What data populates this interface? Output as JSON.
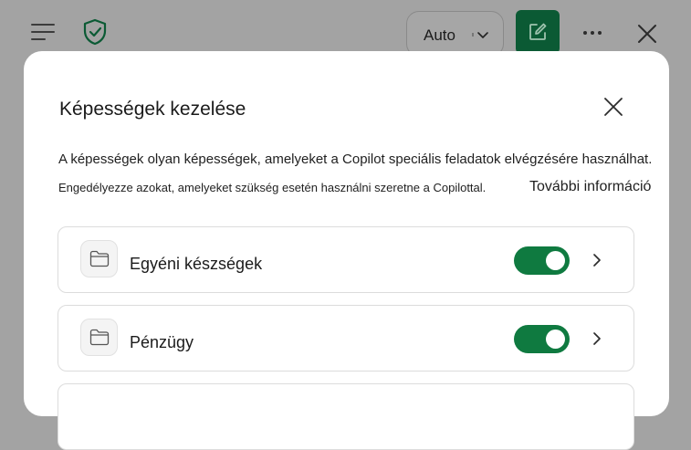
{
  "topbar": {
    "model_select": {
      "value": "Auto"
    }
  },
  "dialog": {
    "title": "Képességek kezelése",
    "description_line1": "A képességek olyan képességek, amelyeket a Copilot speciális feladatok elvégzésére használhat.",
    "description_line2": "Engedélyezze azokat, amelyeket szükség esetén használni szeretne a Copilottal.",
    "learn_more": "További információ",
    "skills": [
      {
        "name": "Egyéni készségek",
        "enabled": true,
        "icon": "folder-icon"
      },
      {
        "name": "Pénzügy",
        "enabled": true,
        "icon": "folder-icon"
      }
    ]
  },
  "colors": {
    "accent": "#0f7a40",
    "compose_button": "#0b5a34",
    "overlay": "#a3a3a3"
  }
}
